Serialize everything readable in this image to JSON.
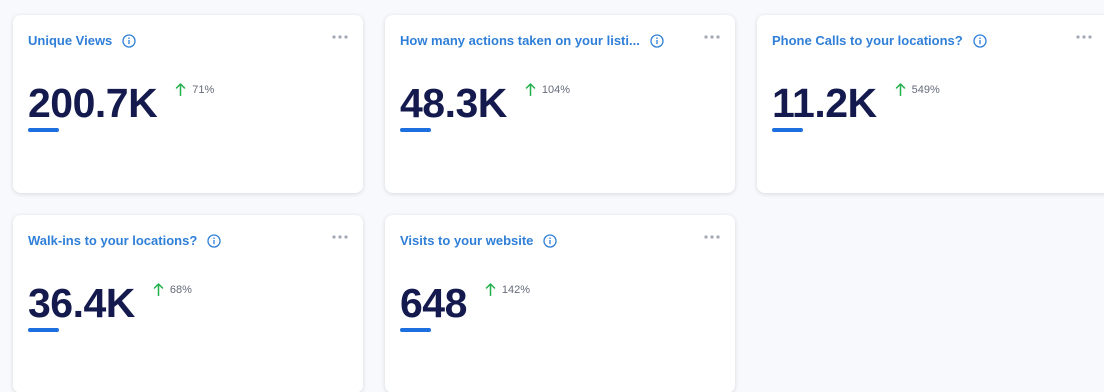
{
  "colors": {
    "title": "#2f7fd8",
    "value": "#141a4d",
    "trend_up": "#21b04b",
    "underline": "#1d6fe0",
    "background": "#f7f9fc"
  },
  "icons": {
    "info": "info-icon",
    "more": "more-options-icon",
    "trend": "arrow-up-icon"
  },
  "cards": [
    {
      "title": "Unique Views",
      "value": "200.7K",
      "change": "71%"
    },
    {
      "title": "How many actions taken on your listi...",
      "value": "48.3K",
      "change": "104%"
    },
    {
      "title": "Phone Calls to your locations?",
      "value": "11.2K",
      "change": "549%"
    },
    {
      "title": "Walk-ins to your locations?",
      "value": "36.4K",
      "change": "68%"
    },
    {
      "title": "Visits to your website",
      "value": "648",
      "change": "142%"
    }
  ]
}
